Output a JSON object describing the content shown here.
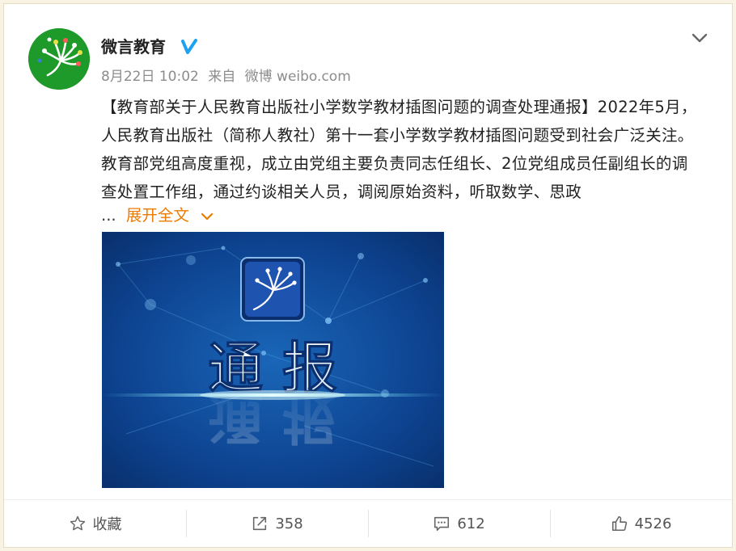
{
  "post": {
    "author": "微言教育",
    "verified_icon": "verified-v-badge-icon",
    "date": "8月22日 10:02",
    "source_prefix": "来自",
    "source": "微博 weibo.com",
    "text": "【教育部关于人民教育出版社小学数学教材插图问题的调查处理通报】2022年5月，人民教育出版社（简称人教社）第十一套小学数学教材插图问题受到社会广泛关注。教育部党组高度重视，成立由党组主要负责同志任组长、2位党组成员任副组长的调查处置工作组，通过约谈相关人员，调阅原始资料，听取数学、思政",
    "ellipsis": "...",
    "expand_label": "展开全文",
    "image": {
      "headline": "通 报",
      "description_icon": "moe-logo-icon"
    }
  },
  "actions": {
    "favorite": {
      "label": "收藏",
      "icon": "star-icon"
    },
    "repost": {
      "count": "358",
      "icon": "share-arrow-icon"
    },
    "comment": {
      "count": "612",
      "icon": "comment-icon"
    },
    "like": {
      "count": "4526",
      "icon": "thumbs-up-icon"
    }
  },
  "colors": {
    "accent": "#eb7b00",
    "verified": "#1da1f2",
    "background": "#f8f3e3",
    "avatar_bg": "#1e9a2a",
    "image_bg": "#0e3f86"
  }
}
